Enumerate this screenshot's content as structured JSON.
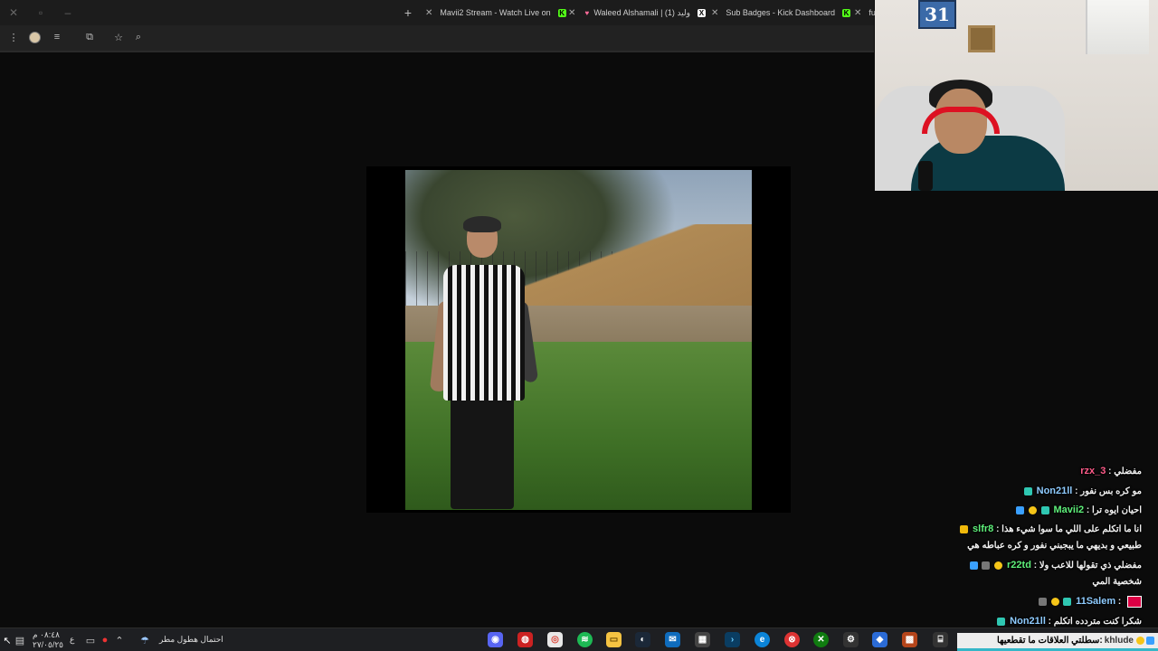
{
  "browser": {
    "tabs": [
      {
        "label": "Mavii2 Stream - Watch Live on",
        "favicon": "kick-icon"
      },
      {
        "label": "Waleed Alshamali | (1) وليد",
        "favicon": "x-icon"
      },
      {
        "label": "Sub Badges - Kick Dashboard",
        "favicon": "kick-icon"
      },
      {
        "label": "fu",
        "favicon": ""
      }
    ],
    "new_tab_symbol": "+",
    "close_symbol": "✕"
  },
  "webcam": {
    "wall_frame_text": "31"
  },
  "chat": {
    "messages": [
      {
        "user": "rzx_3",
        "user_color": "#ff5c8a",
        "text": "مفضلي",
        "badges": []
      },
      {
        "user": "Non21ll",
        "user_color": "#8ecbff",
        "text": "مو كره بس نفور",
        "badges": [
          "teal"
        ]
      },
      {
        "user": "Mavii2",
        "user_color": "#5ef07a",
        "text": "احيان ايوه ترا",
        "badges": [
          "blue",
          "gold",
          "teal"
        ]
      },
      {
        "user": "slfr8",
        "user_color": "#5ef07a",
        "text": "انا ما اتكلم على اللي ما سوا شيء هذا",
        "text2": "طبيعي و بديهي ما يبجبني نفور و كره عباطه هي",
        "badges": [
          "yellow"
        ]
      },
      {
        "user": "r22td",
        "user_color": "#5ef07a",
        "text": "مفضلي ذي تقولها للاعب ولا",
        "text2": "شخصية المي",
        "badges": [
          "blue",
          "gray",
          "gold"
        ]
      },
      {
        "user": "11Salem",
        "user_color": "#8ecbff",
        "text": "",
        "badges": [
          "gray",
          "gold",
          "teal"
        ],
        "emote": true
      },
      {
        "user": "Non21ll",
        "user_color": "#8ecbff",
        "text": "شكرا كنت متردده اتكلم",
        "badges": [
          "teal"
        ]
      }
    ],
    "ticker": {
      "user": "khlude",
      "text": "سطلتي العلاقات ما تقطعيها"
    }
  },
  "taskbar": {
    "weather_text": "احتمال هطول مطر",
    "time": "٠٨:٤٨ م",
    "date": "٢٧/٠٥/٢٥",
    "lang": "ع"
  }
}
